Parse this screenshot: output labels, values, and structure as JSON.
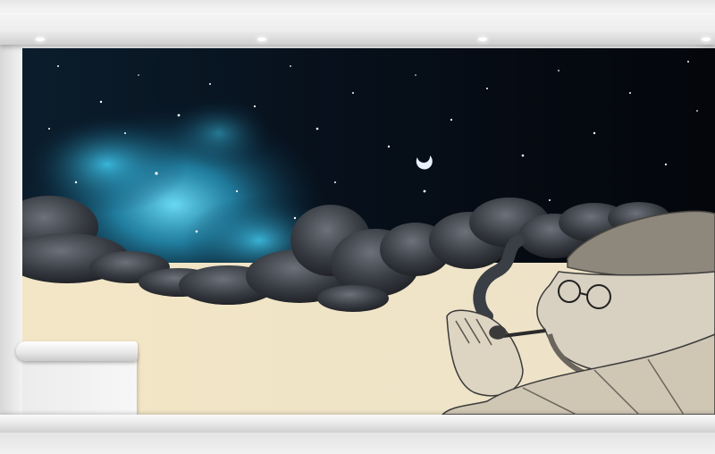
{
  "scene": {
    "subject": "wall-mural-interior",
    "colors": {
      "sky_deep": "#05080f",
      "nebula": "#2fb3d6",
      "cloud_dark": "#2a2d33",
      "wall_paper": "#f2e6c9",
      "wall": "#efefef"
    }
  }
}
